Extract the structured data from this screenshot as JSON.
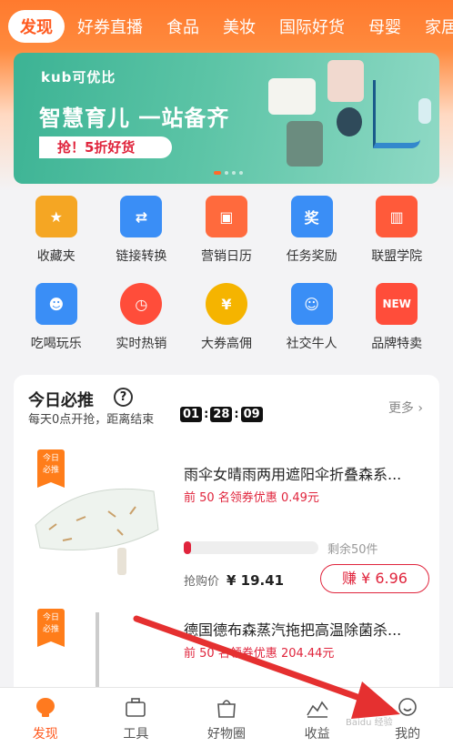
{
  "tabs": [
    {
      "label": "发现",
      "active": true
    },
    {
      "label": "好券直播"
    },
    {
      "label": "食品"
    },
    {
      "label": "美妆"
    },
    {
      "label": "国际好货"
    },
    {
      "label": "母婴"
    },
    {
      "label": "家居"
    }
  ],
  "banner": {
    "logo": "kub可优比",
    "headline": "智慧育儿 一站备齐",
    "promo": "抢！5折好货"
  },
  "grid": [
    {
      "label": "收藏夹",
      "icon": "star-folder-icon",
      "color": "#f5a623"
    },
    {
      "label": "链接转换",
      "icon": "refresh-icon",
      "color": "#3a8ef6"
    },
    {
      "label": "营销日历",
      "icon": "gift-icon",
      "color": "#ff6a3d"
    },
    {
      "label": "任务奖励",
      "icon": "award-icon",
      "color": "#3a8ef6",
      "text": "奖"
    },
    {
      "label": "联盟学院",
      "icon": "building-icon",
      "color": "#ff5a3a"
    },
    {
      "label": "吃喝玩乐",
      "icon": "delivery-icon",
      "color": "#3a8ef6"
    },
    {
      "label": "实时热销",
      "icon": "clock-icon",
      "color": "#ff4d3a"
    },
    {
      "label": "大券高佣",
      "icon": "money-bag-icon",
      "color": "#f5b400",
      "text": "¥"
    },
    {
      "label": "社交牛人",
      "icon": "people-icon",
      "color": "#3a8ef6"
    },
    {
      "label": "品牌特卖",
      "icon": "new-badge-icon",
      "color": "#ff4d3a",
      "text": "NEW"
    }
  ],
  "today": {
    "title": "今日必推",
    "help": "?",
    "subtitle": "每天0点开抢，距离结束",
    "timer": [
      "01",
      "28",
      "09"
    ],
    "more": "更多"
  },
  "items": [
    {
      "tag1": "今日",
      "tag2": "必推",
      "name": "雨伞女晴雨两用遮阳伞折叠森系...",
      "coupon": "前 50 名领券优惠 0.49元",
      "progress": 0.05,
      "remain": "剩余50件",
      "price_label": "抢购价",
      "price": "¥ 19.41",
      "earn": "赚 ¥ 6.96"
    },
    {
      "tag1": "今日",
      "tag2": "必推",
      "name": "德国德布森蒸汽拖把高温除菌杀...",
      "coupon": "前 50 名领券优惠 204.44元"
    }
  ],
  "bottom_nav": [
    {
      "label": "发现",
      "icon": "discover-icon",
      "active": true
    },
    {
      "label": "工具",
      "icon": "toolbox-icon"
    },
    {
      "label": "好物圈",
      "icon": "shopping-bag-icon"
    },
    {
      "label": "收益",
      "icon": "chart-icon"
    },
    {
      "label": "我的",
      "icon": "profile-icon"
    }
  ],
  "colors": {
    "accent": "#ff5a1f",
    "red": "#e0243c",
    "arrow": "#e53030"
  },
  "watermark": "Baidu 经验"
}
